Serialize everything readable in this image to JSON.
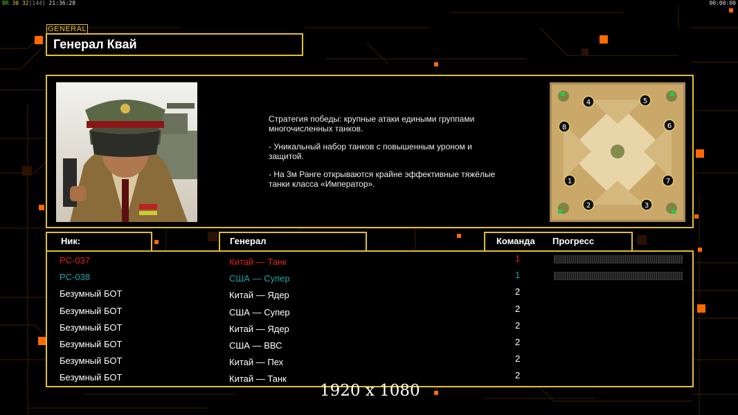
{
  "status": {
    "left_green": "BR",
    "left_a": "30",
    "left_b": "32",
    "left_bracket": "[144]",
    "left_time": "21:36:28",
    "right_time": "00:00:00"
  },
  "header": {
    "tag": "GENERAL",
    "general_name": "Генерал Квай"
  },
  "description": {
    "lines": [
      "Стратегия победы: крупные атаки едиными группами многочисленных танков.",
      "- Уникальный набор танков с повышенным уроном и защитой.",
      "- На 3м Ранге открываются крайне эффективные тяжёлые танки класса «Император»."
    ]
  },
  "minimap": {
    "slots": [
      "1",
      "2",
      "3",
      "4",
      "5",
      "6",
      "7",
      "8"
    ]
  },
  "columns": {
    "nick": "Ник:",
    "general": "Генерал",
    "team": "Команда",
    "progress": "Прогресс"
  },
  "players": [
    {
      "nick": "PC-037",
      "general": "Китай — Танк",
      "team": "1",
      "color": "#e02020",
      "progress": true
    },
    {
      "nick": "PC-038",
      "general": "США — Супер",
      "team": "1",
      "color": "#1fa3a6",
      "progress": true
    },
    {
      "nick": "Безумный БОТ",
      "general": "Китай — Ядер",
      "team": "2",
      "color": "#ffffff",
      "progress": false
    },
    {
      "nick": "Безумный БОТ",
      "general": "США — Супер",
      "team": "2",
      "color": "#ffffff",
      "progress": false
    },
    {
      "nick": "Безумный БОТ",
      "general": "Китай — Ядер",
      "team": "2",
      "color": "#ffffff",
      "progress": false
    },
    {
      "nick": "Безумный БОТ",
      "general": "США — ВВС",
      "team": "2",
      "color": "#ffffff",
      "progress": false
    },
    {
      "nick": "Безумный БОТ",
      "general": "Китай — Пех",
      "team": "2",
      "color": "#ffffff",
      "progress": false
    },
    {
      "nick": "Безумный БОТ",
      "general": "Китай — Танк",
      "team": "2",
      "color": "#ffffff",
      "progress": false
    }
  ],
  "resolution": "1920 x 1080",
  "colors": {
    "accent": "#e2c12c",
    "grid_line": "#5a2a00",
    "square": "#ff6a00"
  }
}
